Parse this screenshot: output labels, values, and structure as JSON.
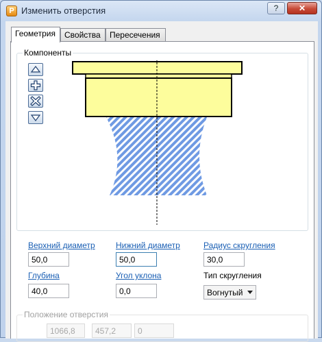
{
  "window": {
    "icon_letter": "P",
    "title": "Изменить отверстия",
    "help_label": "?",
    "close_label": "✕"
  },
  "tabs": [
    {
      "label": "Геометрия",
      "active": true
    },
    {
      "label": "Свойства",
      "active": false
    },
    {
      "label": "Пересечения",
      "active": false
    }
  ],
  "components": {
    "group_label": "Компоненты",
    "buttons": [
      {
        "icon": "arrow-up-icon"
      },
      {
        "icon": "add-icon"
      },
      {
        "icon": "remove-icon"
      },
      {
        "icon": "arrow-down-icon"
      }
    ]
  },
  "fields": {
    "top_diameter": {
      "label": "Верхний диаметр",
      "value": "50,0"
    },
    "bottom_diameter": {
      "label": "Нижний диаметр",
      "value": "50,0"
    },
    "fillet_radius": {
      "label": "Радиус скругления",
      "value": "30,0"
    },
    "depth": {
      "label": "Глубина",
      "value": "40,0"
    },
    "draft_angle": {
      "label": "Угол уклона",
      "value": "0,0"
    },
    "fillet_type": {
      "label": "Тип скругления",
      "value": "Вогнутый"
    }
  },
  "position": {
    "group_label": "Положение отверстия",
    "x": "1066,8",
    "y": "457,2",
    "z": "0"
  },
  "colors": {
    "accent": "#1a5fb4",
    "hole_yellow": "#fdfd9c",
    "hatch_blue": "#6f9ae3"
  }
}
